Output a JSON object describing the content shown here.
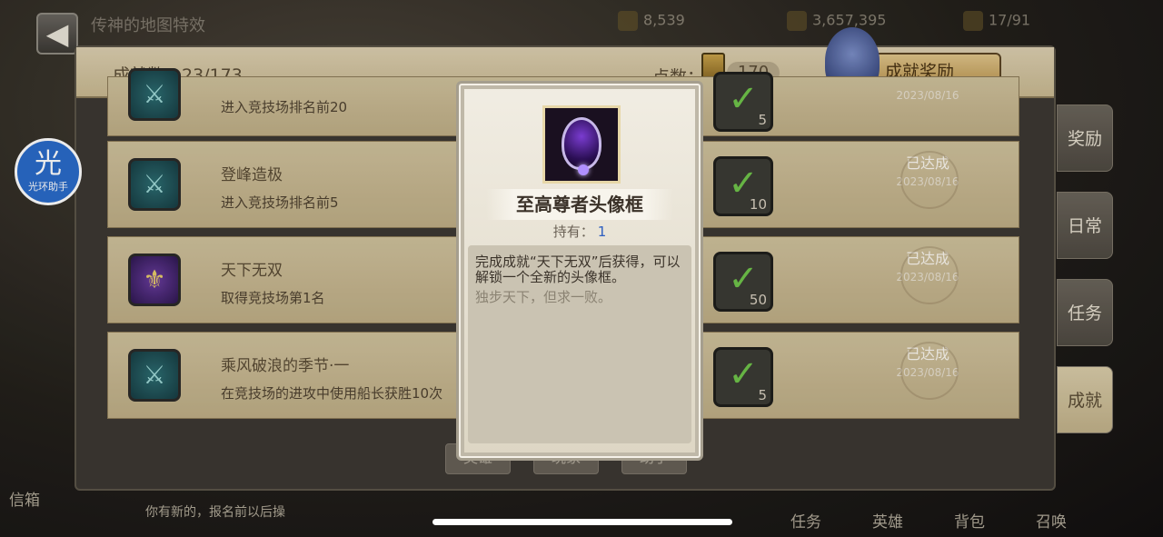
{
  "top": {
    "bg_title": "传神的地图特效",
    "resources": [
      "8,539",
      "3,657,395",
      "17/91"
    ]
  },
  "header": {
    "achievement_count": "成就数：23/173",
    "points_label": "点数：",
    "points_value": "170",
    "reward_button": "成就奖励"
  },
  "rows": [
    {
      "name": "",
      "desc": "进入竞技场排名前20",
      "points": "5",
      "status": "",
      "date": "2023/08/16"
    },
    {
      "name": "登峰造极",
      "desc": "进入竞技场排名前5",
      "points": "10",
      "status": "已达成",
      "date": "2023/08/16"
    },
    {
      "name": "天下无双",
      "desc": "取得竞技场第1名",
      "points": "50",
      "status": "已达成",
      "date": "2023/08/16"
    },
    {
      "name": "乘风破浪的季节·一",
      "desc": "在竞技场的进攻中使用船长获胜10次",
      "points": "5",
      "status": "已达成",
      "date": "2023/08/16"
    }
  ],
  "side_tabs": [
    "奖励",
    "日常",
    "任务",
    "成就"
  ],
  "helper": {
    "big": "光",
    "small": "光环助手"
  },
  "bottom_buttons": [
    "英雄",
    "玩家",
    "助手"
  ],
  "bottom_nav": {
    "left": "信箱",
    "left_msg": "你有新的，报名前以后操",
    "items": [
      "任务",
      "英雄",
      "背包",
      "召唤"
    ]
  },
  "modal": {
    "item_name": "至高尊者头像框",
    "own_label": "持有：",
    "own_count": "1",
    "description": "完成成就“天下无双”后获得，可以解锁一个全新的头像框。",
    "flavor": "独步天下，但求一败。"
  },
  "colors": {
    "accent": "#2e5fc0",
    "check": "#6fc44a",
    "panel": "#cfc19c"
  }
}
